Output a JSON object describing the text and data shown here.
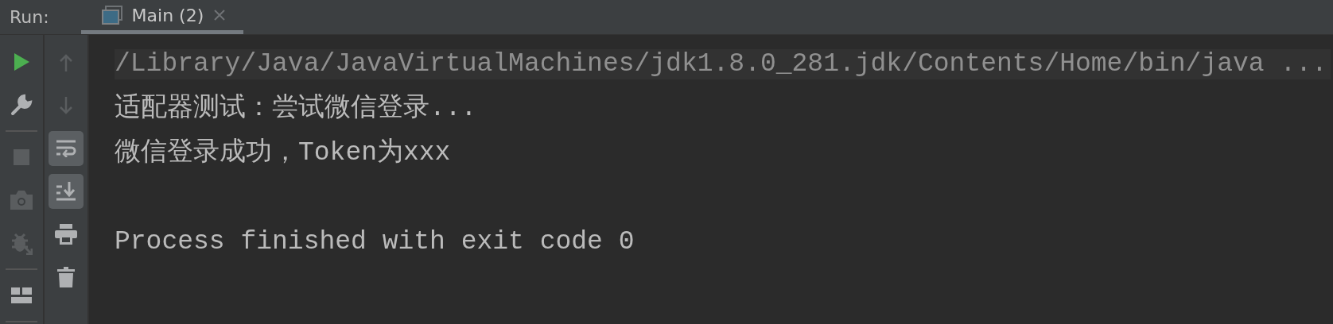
{
  "header": {
    "label": "Run:"
  },
  "tabs": [
    {
      "label": "Main (2)",
      "selected": true
    }
  ],
  "toolbar_left": [
    {
      "kind": "run",
      "disabled": false
    },
    {
      "kind": "wrench",
      "disabled": false
    },
    {
      "kind": "divider"
    },
    {
      "kind": "stop",
      "disabled": true
    },
    {
      "kind": "camera",
      "disabled": true
    },
    {
      "kind": "debug",
      "disabled": true
    },
    {
      "kind": "divider"
    },
    {
      "kind": "layout",
      "disabled": false
    },
    {
      "kind": "divider"
    }
  ],
  "toolbar_right": [
    {
      "kind": "up",
      "on": false,
      "disabled": true
    },
    {
      "kind": "down",
      "on": false,
      "disabled": true
    },
    {
      "kind": "wrap",
      "on": true,
      "disabled": false
    },
    {
      "kind": "scroll",
      "on": true,
      "disabled": false
    },
    {
      "kind": "print",
      "on": false,
      "disabled": false
    },
    {
      "kind": "trash",
      "on": false,
      "disabled": false
    }
  ],
  "console": {
    "lines": [
      {
        "kind": "command",
        "text": "/Library/Java/JavaVirtualMachines/jdk1.8.0_281.jdk/Contents/Home/bin/java ..."
      },
      {
        "kind": "output",
        "text": "适配器测试：尝试微信登录..."
      },
      {
        "kind": "output",
        "text": "微信登录成功，Token为xxx"
      },
      {
        "kind": "system",
        "text": "Process finished with exit code 0"
      }
    ]
  }
}
